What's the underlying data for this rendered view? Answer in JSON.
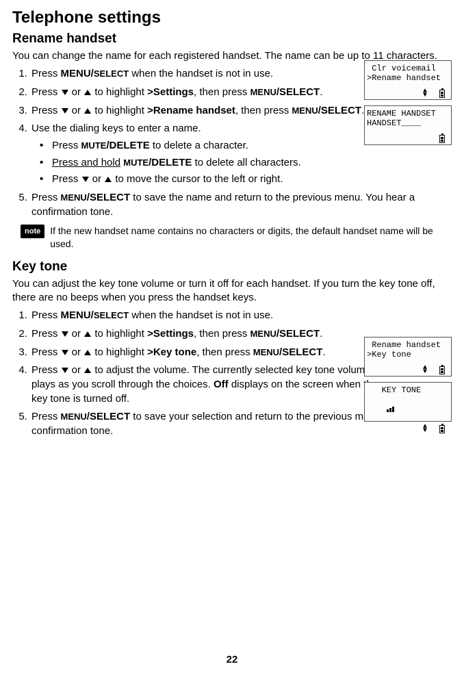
{
  "page_title": "Telephone settings",
  "section1": {
    "heading": "Rename handset",
    "intro": "You can change the name for each registered handset. The name can be up to 11 characters.",
    "step1_a": "Press ",
    "step1_b": "MENU/",
    "step1_c": "SELECT",
    "step1_d": " when the handset is not in use.",
    "step2_a": "Press ",
    "step2_b": " or ",
    "step2_c": " to highlight ",
    "step2_d": ">Settings",
    "step2_e": ", then press ",
    "step2_f": "MENU",
    "step2_g": "/SELECT",
    "step2_h": ".",
    "step3_a": "Press ",
    "step3_b": " or ",
    "step3_c": " to highlight ",
    "step3_d": ">Rename handset",
    "step3_e": ", then press ",
    "step3_f": "MENU",
    "step3_g": "/SELECT",
    "step3_h": ".",
    "step4": "Use the dialing keys to enter a name.",
    "bullet1_a": "Press ",
    "bullet1_b": "MUTE",
    "bullet1_c": "/DELETE",
    "bullet1_d": " to delete a character.",
    "bullet2_a": "Press and hold",
    "bullet2_b": " ",
    "bullet2_c": "MUTE",
    "bullet2_d": "/DELETE",
    "bullet2_e": " to delete all characters.",
    "bullet3_a": "Press ",
    "bullet3_b": " or ",
    "bullet3_c": " to move the cursor to the left or right.",
    "step5_a": "Press ",
    "step5_b": "MENU",
    "step5_c": "/SELECT",
    "step5_d": " to save the name and return to the previous menu. You hear a confirmation tone.",
    "note": "If the new handset name contains no characters or digits, the default handset name will be used."
  },
  "section2": {
    "heading": "Key tone",
    "intro": "You can adjust the key tone volume or turn it off for each handset. If you turn the key tone off, there are no beeps when you press the handset keys.",
    "step1_a": "Press ",
    "step1_b": "MENU/",
    "step1_c": "SELECT",
    "step1_d": " when the handset is not in use.",
    "step2_a": "Press ",
    "step2_b": " or ",
    "step2_c": " to highlight ",
    "step2_d": ">Settings",
    "step2_e": ", then press ",
    "step2_f": "MENU",
    "step2_g": "/SELECT",
    "step2_h": ".",
    "step3_a": "Press ",
    "step3_b": " or ",
    "step3_c": " to highlight ",
    "step3_d": ">Key tone",
    "step3_e": ", then press ",
    "step3_f": "MENU",
    "step3_g": "/SELECT",
    "step3_h": ".",
    "step4_a": "Press ",
    "step4_b": " or ",
    "step4_c": " to adjust the volume. The currently selected key tone volume plays as you scroll through the choices. ",
    "step4_d": "Off",
    "step4_e": " displays on the screen when the key tone is turned off.",
    "step5_a": "Press ",
    "step5_b": "MENU",
    "step5_c": "/SELECT",
    "step5_d": " to save your selection and return to the previous menu. You hear a confirmation tone."
  },
  "lcd1_line1": " Clr voicemail",
  "lcd1_line2": ">Rename handset",
  "lcd2_line1": "RENAME HANDSET",
  "lcd2_line2": "HANDSET____",
  "lcd3_line1": " Rename handset",
  "lcd3_line2": ">Key tone",
  "lcd4_line1": "   KEY TONE",
  "note_label": "note",
  "page_number": "22"
}
